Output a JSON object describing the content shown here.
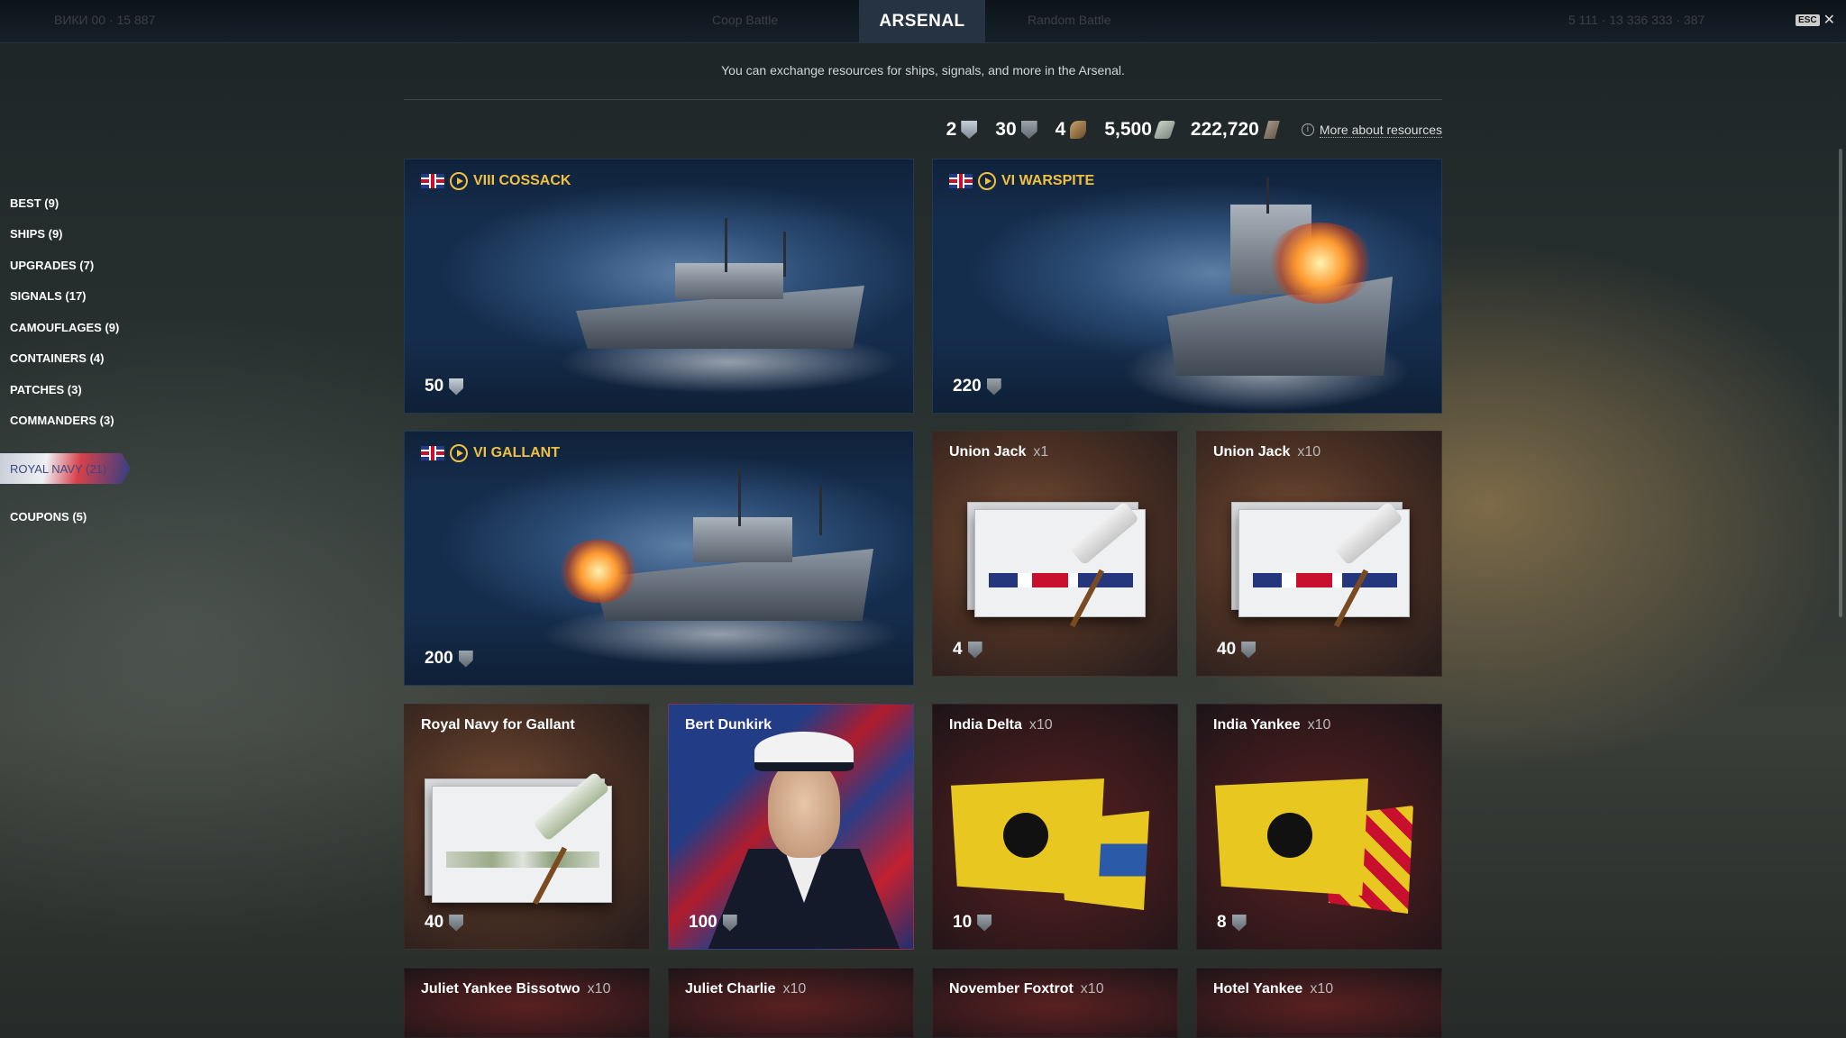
{
  "header": {
    "active_tab": "ARSENAL",
    "ghost_left": "ВИКИ 00 · 15 887",
    "ghost_mid_left": "Coop Battle",
    "ghost_mid_right": "Random Battle",
    "ghost_right": "5 111 · 13 336 333 · 387",
    "esc_label": "ESC",
    "close_glyph": "✕"
  },
  "subtitle": "You can exchange resources for ships, signals, and more in the Arsenal.",
  "resources": [
    {
      "value": "2",
      "icon": "steel-icon"
    },
    {
      "value": "30",
      "icon": "coal-icon"
    },
    {
      "value": "4",
      "icon": "research-bureau-icon"
    },
    {
      "value": "5,500",
      "icon": "credits-icon"
    },
    {
      "value": "222,720",
      "icon": "free-xp-icon"
    }
  ],
  "more_resources": "More about resources",
  "sidebar": {
    "items": [
      {
        "label": "BEST (9)"
      },
      {
        "label": "SHIPS (9)"
      },
      {
        "label": "UPGRADES (7)"
      },
      {
        "label": "SIGNALS (17)"
      },
      {
        "label": "CAMOUFLAGES (9)"
      },
      {
        "label": "CONTAINERS (4)"
      },
      {
        "label": "PATCHES (3)"
      },
      {
        "label": "COMMANDERS (3)"
      },
      {
        "label": "ROYAL NAVY (21)"
      },
      {
        "label": "COUPONS (5)"
      }
    ],
    "active_index": 8
  },
  "cards": {
    "cossack": {
      "title": "VIII COSSACK",
      "price": "50",
      "currency": "steel-icon"
    },
    "warspite": {
      "title": "VI WARSPITE",
      "price": "220",
      "currency": "coal-icon"
    },
    "gallant": {
      "title": "VI GALLANT",
      "price": "200",
      "currency": "coal-icon"
    },
    "union_jack_1": {
      "title": "Union Jack",
      "qty": "x1",
      "price": "4",
      "currency": "coal-icon"
    },
    "union_jack_10": {
      "title": "Union Jack",
      "qty": "x10",
      "price": "40",
      "currency": "coal-icon"
    },
    "rn_gallant": {
      "title": "Royal Navy for Gallant",
      "price": "40",
      "currency": "coal-icon"
    },
    "bert": {
      "title": "Bert Dunkirk",
      "price": "100",
      "currency": "coal-icon"
    },
    "india_delta": {
      "title": "India Delta",
      "qty": "x10",
      "price": "10",
      "currency": "coal-icon"
    },
    "india_yankee": {
      "title": "India Yankee",
      "qty": "x10",
      "price": "8",
      "currency": "coal-icon"
    },
    "jyb": {
      "title": "Juliet Yankee Bissotwo",
      "qty": "x10"
    },
    "jc": {
      "title": "Juliet Charlie",
      "qty": "x10"
    },
    "nf": {
      "title": "November Foxtrot",
      "qty": "x10"
    },
    "hy": {
      "title": "Hotel Yankee",
      "qty": "x10"
    }
  },
  "colors": {
    "ship_title": "#f0c040",
    "accent_tab": "#263342"
  }
}
